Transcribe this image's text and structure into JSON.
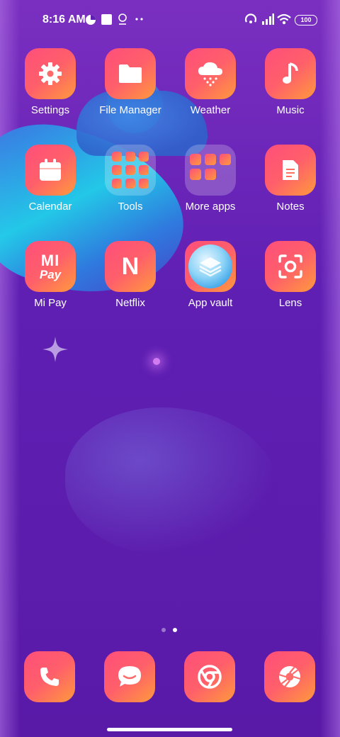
{
  "status_bar": {
    "time": "8:16 AM",
    "battery": "100",
    "icons": [
      "data-saver-icon",
      "square-notification-icon",
      "location-icon",
      "more-dots-icon",
      "hotspot-icon",
      "signal-icon",
      "wifi-icon",
      "battery-icon"
    ]
  },
  "apps": {
    "settings": "Settings",
    "file_manager": "File Manager",
    "weather": "Weather",
    "music": "Music",
    "calendar": "Calendar",
    "tools": "Tools",
    "more_apps": "More apps",
    "notes": "Notes",
    "mi_pay": "Mi Pay",
    "netflix": "Netflix",
    "app_vault": "App vault",
    "lens": "Lens"
  },
  "icon_glyphs": {
    "mi_pay_top": "MI",
    "mi_pay_bottom": "Pay",
    "netflix": "N"
  },
  "pages": {
    "count": 2,
    "current": 2
  },
  "dock": [
    "phone-icon",
    "messages-icon",
    "chrome-icon",
    "camera-icon"
  ],
  "colors": {
    "tile_gradient_start": "#ff4f7b",
    "tile_gradient_end": "#ff9a3c",
    "wallpaper": "#5f1fb3"
  }
}
